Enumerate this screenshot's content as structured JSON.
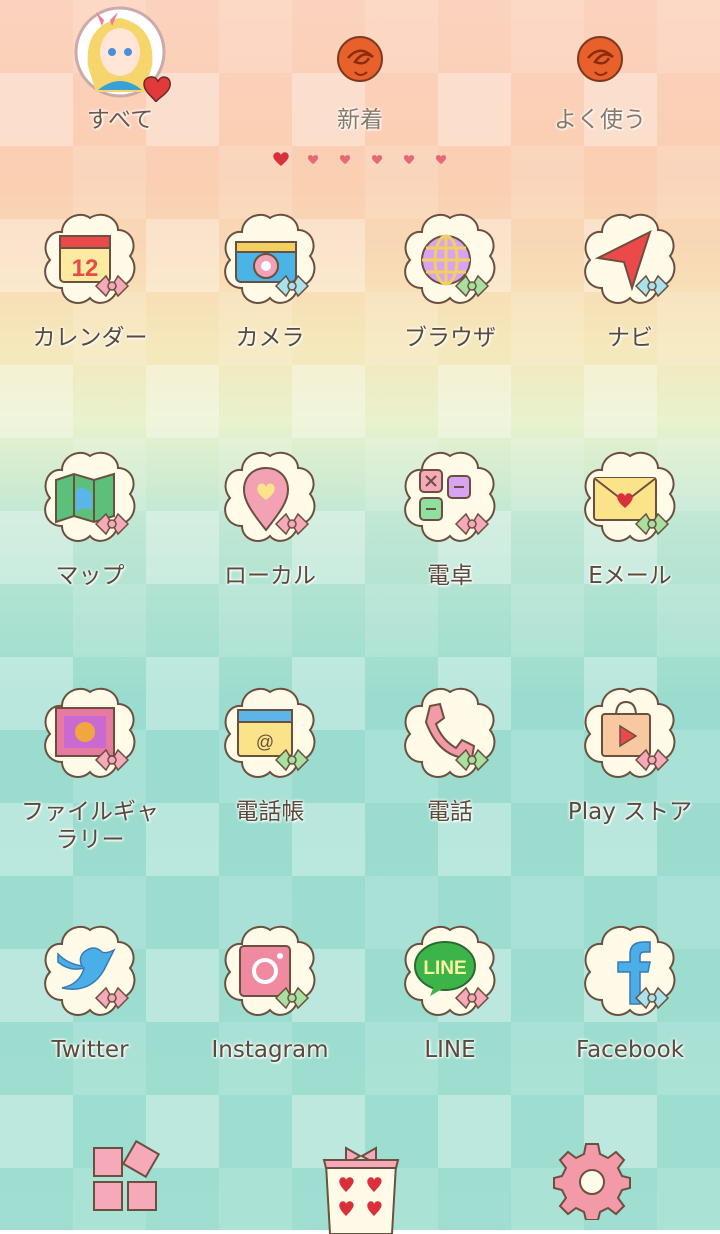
{
  "tabs": [
    {
      "label": "すべて",
      "icon": "avatar-icon",
      "active": true
    },
    {
      "label": "新着",
      "icon": "rose-icon",
      "active": false
    },
    {
      "label": "よく使う",
      "icon": "rose-icon",
      "active": false
    }
  ],
  "page_indicator": {
    "total": 6,
    "current": 1
  },
  "apps": [
    {
      "label": "カレンダー",
      "icon": "calendar-icon",
      "calendar_day": "12"
    },
    {
      "label": "カメラ",
      "icon": "camera-icon"
    },
    {
      "label": "ブラウザ",
      "icon": "globe-icon"
    },
    {
      "label": "ナビ",
      "icon": "navigation-arrow-icon"
    },
    {
      "label": "マップ",
      "icon": "map-icon"
    },
    {
      "label": "ローカル",
      "icon": "location-pin-icon"
    },
    {
      "label": "電卓",
      "icon": "calculator-icon"
    },
    {
      "label": "Eメール",
      "icon": "envelope-icon"
    },
    {
      "label": "ファイルギャ\nラリー",
      "icon": "picture-frame-icon"
    },
    {
      "label": "電話帳",
      "icon": "address-book-icon"
    },
    {
      "label": "電話",
      "icon": "phone-handset-icon"
    },
    {
      "label": "Play ストア",
      "icon": "shopping-bag-play-icon"
    },
    {
      "label": "Twitter",
      "icon": "twitter-bird-icon"
    },
    {
      "label": "Instagram",
      "icon": "instagram-camera-icon"
    },
    {
      "label": "LINE",
      "icon": "line-bubble-icon",
      "badge_text": "LINE"
    },
    {
      "label": "Facebook",
      "icon": "facebook-f-icon"
    }
  ],
  "dock": [
    {
      "icon": "app-drawer-grid-icon"
    },
    {
      "icon": "gift-box-hearts-icon"
    },
    {
      "icon": "settings-gear-icon"
    }
  ],
  "colors": {
    "label": "#5a4a3c",
    "heart": "#d9303c",
    "bow_pink": "#f6a9b8",
    "bow_green": "#a8e0a0",
    "bow_blue": "#a9e2ea",
    "cloud": "#fffbe8"
  }
}
